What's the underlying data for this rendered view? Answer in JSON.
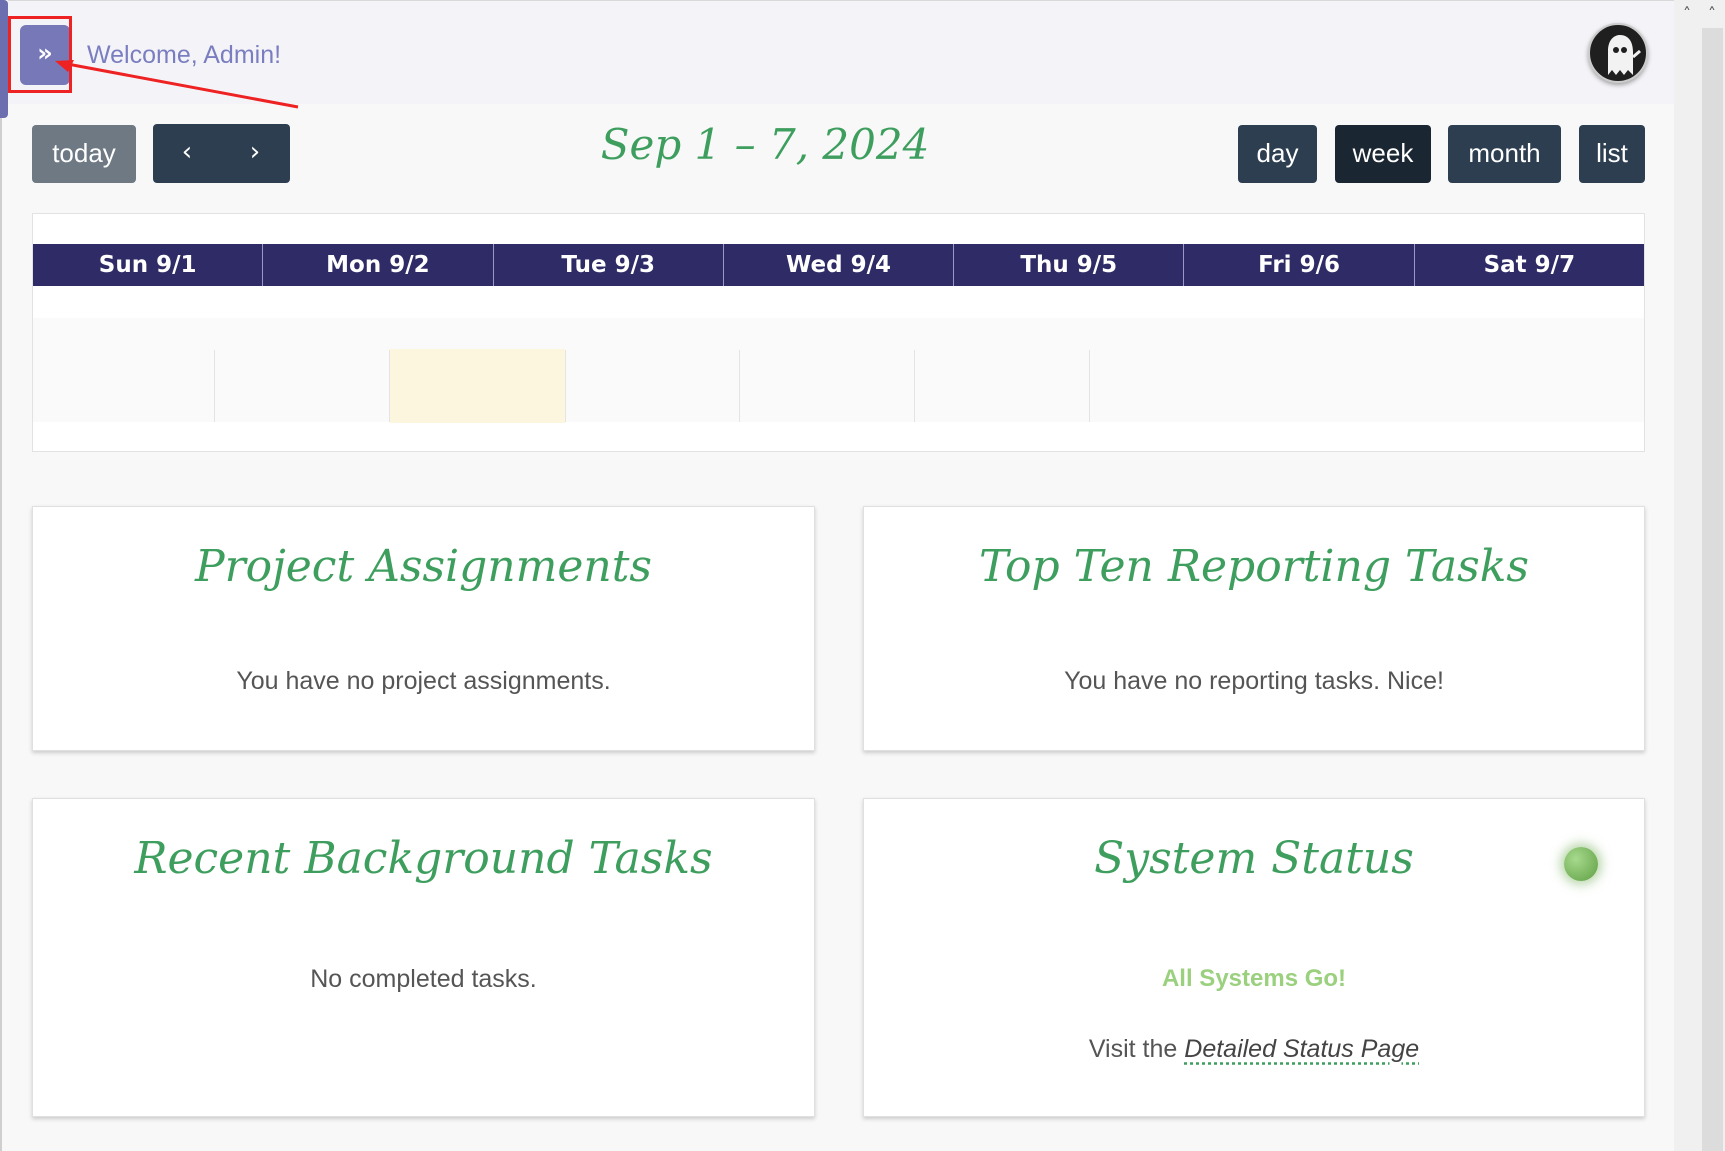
{
  "header": {
    "welcome_text": "Welcome, Admin!"
  },
  "toolbar": {
    "today_label": "today",
    "prev_label": "‹",
    "next_label": "›",
    "date_range": "Sep 1 – 7, 2024",
    "views": [
      "day",
      "week",
      "month",
      "list"
    ],
    "active_view": "week"
  },
  "calendar": {
    "days": [
      "Sun 9/1",
      "Mon 9/2",
      "Tue 9/3",
      "Wed 9/4",
      "Thu 9/5",
      "Fri 9/6",
      "Sat 9/7"
    ],
    "today_highlight_color": "#fcf6df",
    "header_color": "#2e2b66"
  },
  "cards": {
    "projects": {
      "title": "Project Assignments",
      "message": "You have no project assignments."
    },
    "reporting": {
      "title": "Top Ten Reporting Tasks",
      "message": "You have no reporting tasks. Nice!"
    },
    "background": {
      "title": "Recent Background Tasks",
      "message": "No completed tasks."
    },
    "status": {
      "title": "System Status",
      "status_text": "All Systems Go!",
      "visit_prefix": "Visit the ",
      "link_text": "Detailed Status Page"
    }
  },
  "colors": {
    "accent_green": "#3d9e5e",
    "nav_dark": "#2c3e50",
    "toggle_purple": "#7678b8"
  },
  "icons": {
    "sidebar_toggle": "double-chevron-right-icon",
    "avatar": "ghost-avatar-icon",
    "status": "status-indicator-icon"
  }
}
